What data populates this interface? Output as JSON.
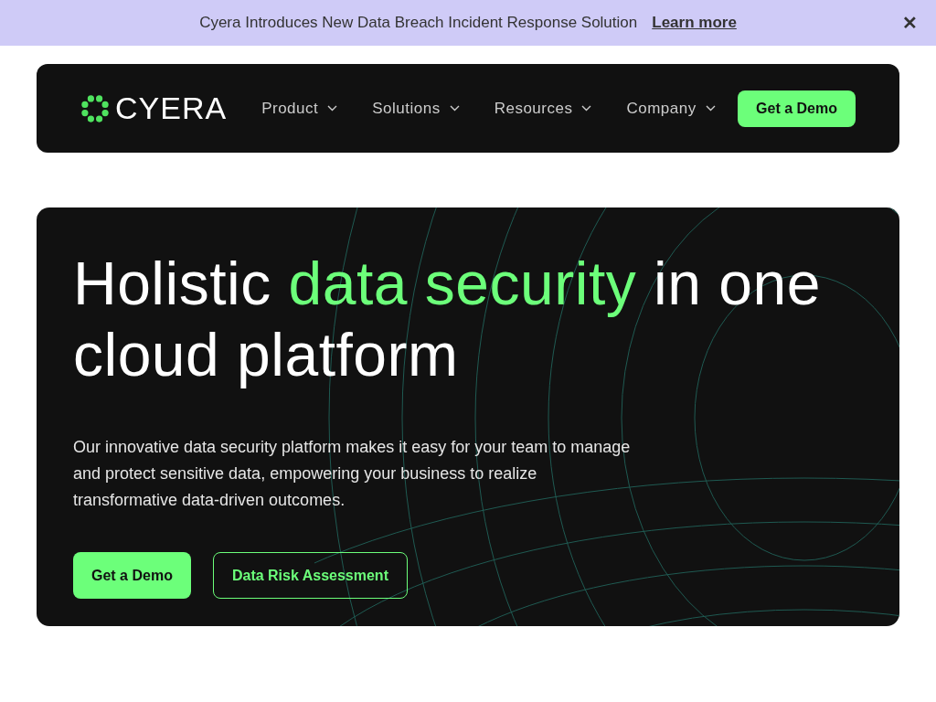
{
  "announcement": {
    "text": "Cyera Introduces New Data Breach Incident Response Solution",
    "link": "Learn more",
    "close": "✕"
  },
  "nav": {
    "logo": "CYERA",
    "items": [
      {
        "label": "Product"
      },
      {
        "label": "Solutions"
      },
      {
        "label": "Resources"
      },
      {
        "label": "Company"
      }
    ],
    "cta": "Get a Demo"
  },
  "hero": {
    "headline": {
      "before": "Holistic ",
      "highlight": "data security",
      "after": " in one cloud platform"
    },
    "body": "Our innovative data security platform makes it easy for your team to manage and protect sensitive data, empowering your business to realize transformative data-driven outcomes.",
    "buttons": [
      {
        "label": "Get a Demo",
        "kind": "primary"
      },
      {
        "label": "Data Risk Assessment",
        "kind": "outline"
      }
    ]
  }
}
